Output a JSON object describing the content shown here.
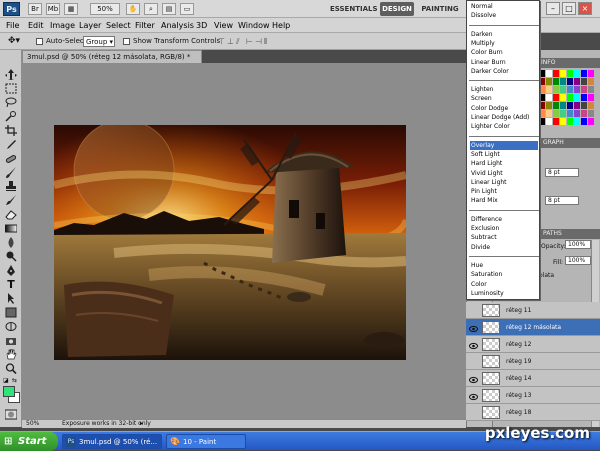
{
  "appbar": {
    "logo": "Ps",
    "zoom": "50%",
    "workspaces": [
      "ESSENTIALS",
      "DESIGN",
      "PAINTING"
    ],
    "active_workspace": "DESIGN",
    "window_controls": [
      "–",
      "□",
      "×"
    ]
  },
  "menubar": {
    "items": [
      "File",
      "Edit",
      "Image",
      "Layer",
      "Select",
      "Filter",
      "Analysis",
      "3D",
      "View",
      "Window",
      "Help"
    ]
  },
  "options": {
    "auto_select_label": "Auto-Select:",
    "auto_select_value": "Group",
    "show_transform_label": "Show Transform Controls"
  },
  "document": {
    "tab_title": "3mul.psd @ 50% (réteg 12 másolata, RGB/8) *",
    "zoom": "50%",
    "status": "Exposure works in 32-bit only"
  },
  "blend_modes": {
    "groups": [
      [
        "Normal",
        "Dissolve"
      ],
      [
        "Darken",
        "Multiply",
        "Color Burn",
        "Linear Burn",
        "Darker Color"
      ],
      [
        "Lighten",
        "Screen",
        "Color Dodge",
        "Linear Dodge (Add)",
        "Lighter Color"
      ],
      [
        "Overlay",
        "Soft Light",
        "Hard Light",
        "Vivid Light",
        "Linear Light",
        "Pin Light",
        "Hard Mix"
      ],
      [
        "Difference",
        "Exclusion",
        "Subtract",
        "Divide"
      ],
      [
        "Hue",
        "Saturation",
        "Color",
        "Luminosity"
      ]
    ],
    "highlighted": "Overlay"
  },
  "panels": {
    "swatches_tab": "INFO",
    "graph_tab": "GRAPH",
    "size_a": "8 pt",
    "size_b": "8 pt",
    "paths_tab": "PATHS",
    "opacity_label": "Opacity:",
    "opacity": "100%",
    "fill_label": "Fill:",
    "fill": "100%",
    "partial_layer": "olata"
  },
  "layers": [
    {
      "name": "réteg 11",
      "visible": false,
      "selected": false
    },
    {
      "name": "réteg 12 másolata",
      "visible": true,
      "selected": true
    },
    {
      "name": "réteg 12",
      "visible": true,
      "selected": false
    },
    {
      "name": "réteg 19",
      "visible": false,
      "selected": false
    },
    {
      "name": "réteg 14",
      "visible": true,
      "selected": false
    },
    {
      "name": "réteg 13",
      "visible": true,
      "selected": false
    },
    {
      "name": "réteg 18",
      "visible": false,
      "selected": false
    }
  ],
  "taskbar": {
    "start": "Start",
    "items": [
      "3mul.psd @ 50% (ré...",
      "10 - Paint"
    ]
  },
  "watermark": "pxleyes.com",
  "colors": {
    "foreground": "#2ee37a",
    "background": "#ffffff",
    "highlight": "#3a6fc4"
  }
}
